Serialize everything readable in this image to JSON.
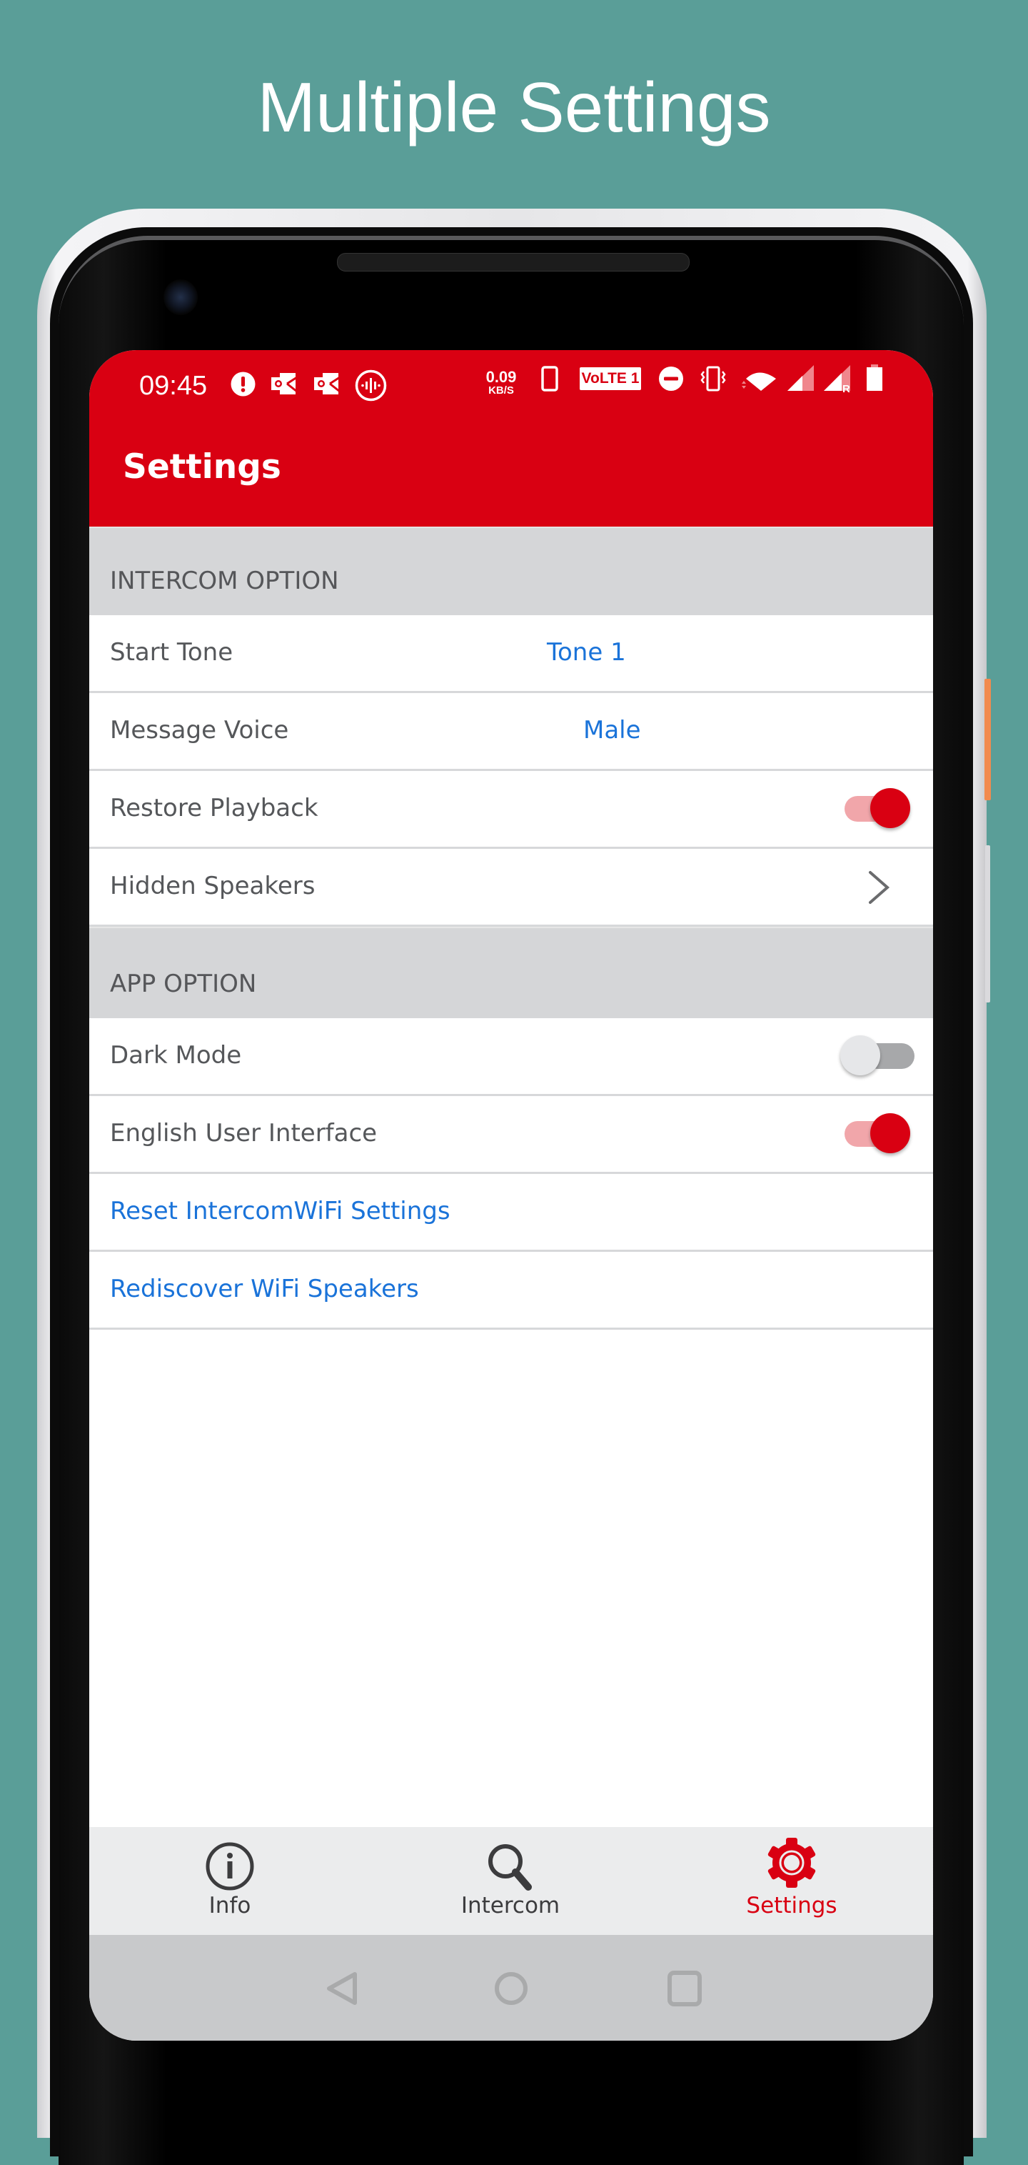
{
  "promo": {
    "title": "Multiple Settings"
  },
  "status_bar": {
    "time": "09:45",
    "net_speed_value": "0.09",
    "net_speed_unit": "KB/S",
    "volte_label": "VoLTE 1",
    "roaming_label": "R",
    "left_icons": [
      "alert-icon",
      "outlook-icon",
      "outlook-icon",
      "voice-recorder-icon"
    ],
    "right_icons": [
      "phone-device-icon",
      "volte-icon",
      "do-not-disturb-icon",
      "vibrate-icon",
      "wifi-icon",
      "signal-icon",
      "signal-roaming-icon",
      "battery-icon"
    ]
  },
  "app_bar": {
    "title": "Settings"
  },
  "sections": [
    {
      "header": "INTERCOM OPTION",
      "rows": [
        {
          "label": "Start Tone",
          "value": "Tone 1",
          "type": "value"
        },
        {
          "label": "Message Voice",
          "value": "Male",
          "type": "value"
        },
        {
          "label": "Restore Playback",
          "type": "toggle",
          "enabled": true
        },
        {
          "label": "Hidden Speakers",
          "type": "navigation"
        }
      ]
    },
    {
      "header": "APP OPTION",
      "rows": [
        {
          "label": "Dark Mode",
          "type": "toggle",
          "enabled": false
        },
        {
          "label": "English User Interface",
          "type": "toggle",
          "enabled": true
        },
        {
          "label": "Reset IntercomWiFi Settings",
          "type": "action"
        },
        {
          "label": "Rediscover WiFi Speakers",
          "type": "action"
        }
      ]
    }
  ],
  "bottom_nav": {
    "items": [
      {
        "label": "Info",
        "icon": "info-icon",
        "active": false
      },
      {
        "label": "Intercom",
        "icon": "search-icon",
        "active": false
      },
      {
        "label": "Settings",
        "icon": "gear-icon",
        "active": true
      }
    ]
  },
  "system_nav": {
    "buttons": [
      "back",
      "home",
      "recents"
    ]
  },
  "colors": {
    "background": "#5a9e98",
    "primary": "#d90012",
    "link": "#1a73d9",
    "section_header_bg": "#d5d6d8",
    "toggle_on_track": "#f1a6aa",
    "toggle_off_track": "#a7a8aa"
  }
}
